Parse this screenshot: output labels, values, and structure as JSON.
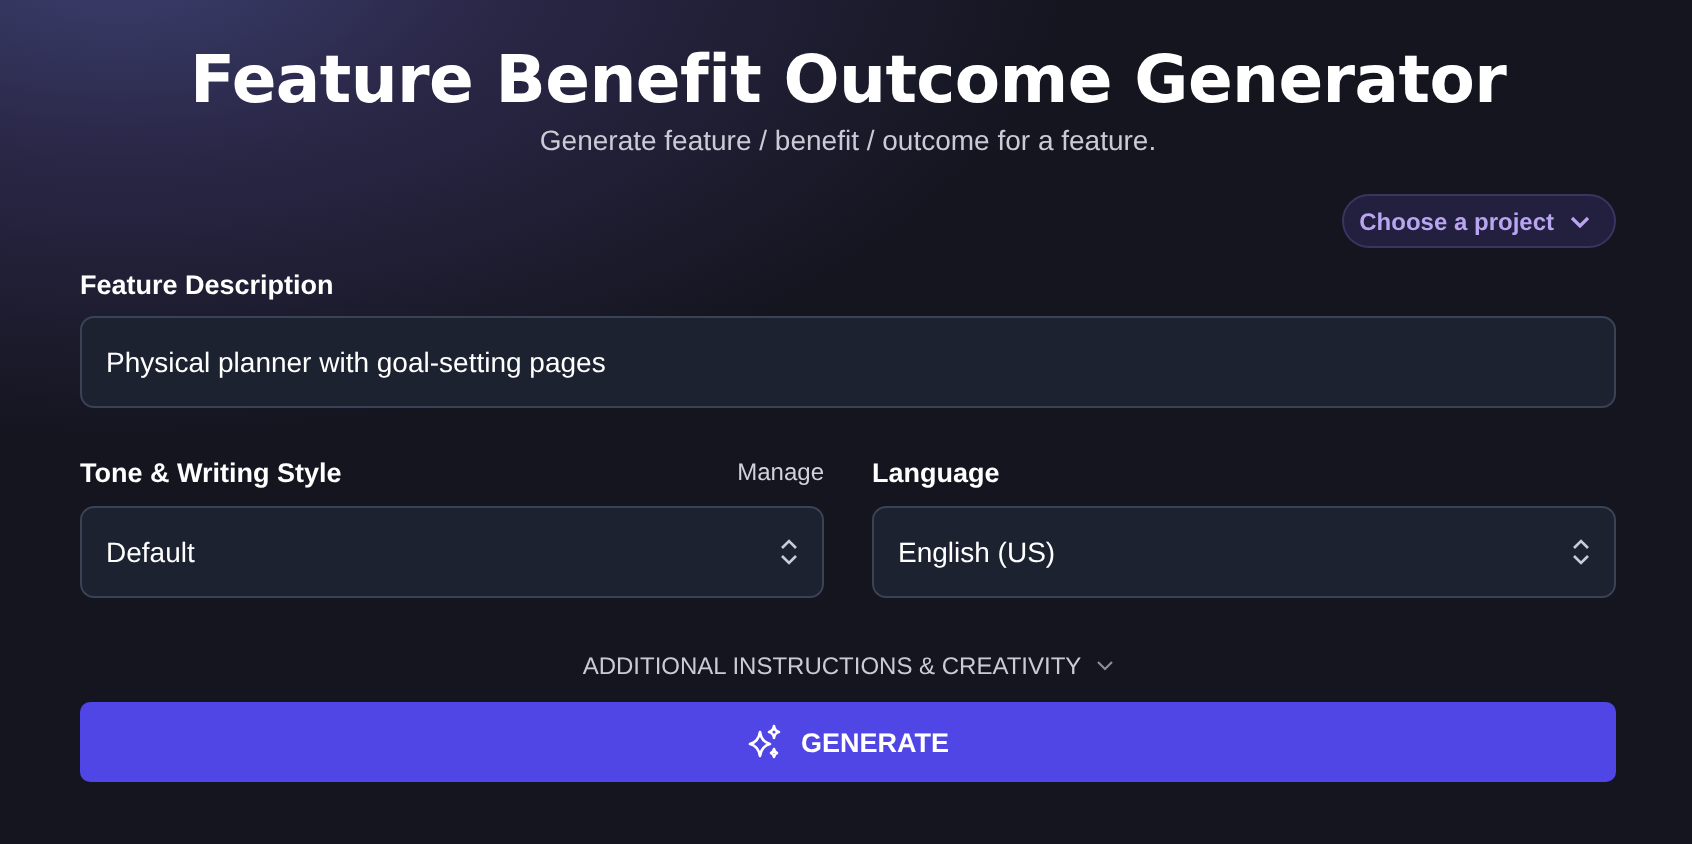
{
  "header": {
    "title": "Feature Benefit Outcome Generator",
    "subtitle": "Generate feature / benefit / outcome for a feature."
  },
  "project_picker": {
    "label": "Choose a project"
  },
  "feature_description": {
    "label": "Feature Description",
    "value": "Physical planner with goal-setting pages"
  },
  "tone": {
    "label": "Tone & Writing Style",
    "link": "Manage",
    "value": "Default"
  },
  "language": {
    "label": "Language",
    "value": "English (US)"
  },
  "additional": {
    "label": "ADDITIONAL INSTRUCTIONS & CREATIVITY",
    "expanded": false
  },
  "generate_button": {
    "label": "GENERATE"
  }
}
